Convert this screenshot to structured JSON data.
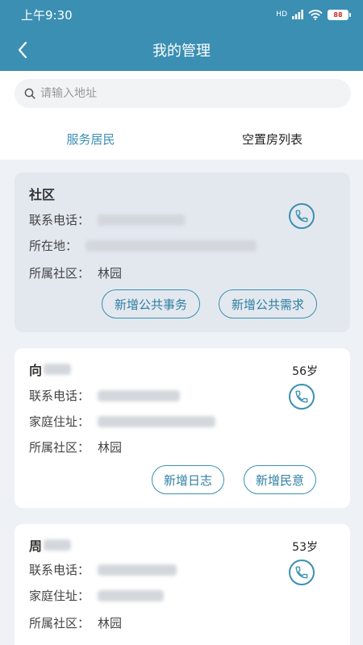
{
  "status_bar": {
    "time": "上午9:30",
    "network": "HD",
    "battery": "88"
  },
  "nav": {
    "title": "我的管理"
  },
  "search": {
    "placeholder": "请输入地址"
  },
  "tabs": [
    {
      "label": "服务居民",
      "active": true
    },
    {
      "label": "空置房列表",
      "active": false
    }
  ],
  "community_card": {
    "title": "社区",
    "phone_label": "联系电话：",
    "location_label": "所在地：",
    "community_label": "所属社区：",
    "community_value": "林园",
    "buttons": [
      "新增公共事务",
      "新增公共需求"
    ]
  },
  "residents": [
    {
      "surname": "向",
      "age": "56岁",
      "phone_label": "联系电话：",
      "address_label": "家庭住址：",
      "community_label": "所属社区：",
      "community_value": "林园",
      "buttons": [
        "新增日志",
        "新增民意"
      ]
    },
    {
      "surname": "周",
      "age": "53岁",
      "phone_label": "联系电话：",
      "address_label": "家庭住址：",
      "community_label": "所属社区：",
      "community_value": "林园",
      "buttons": []
    }
  ],
  "colors": {
    "primary": "#3b8fb3",
    "background": "#eef1f6",
    "community_card": "#e3e8ef"
  },
  "icons": {
    "back": "chevron-left-icon",
    "search": "search-icon",
    "phone": "phone-icon"
  }
}
